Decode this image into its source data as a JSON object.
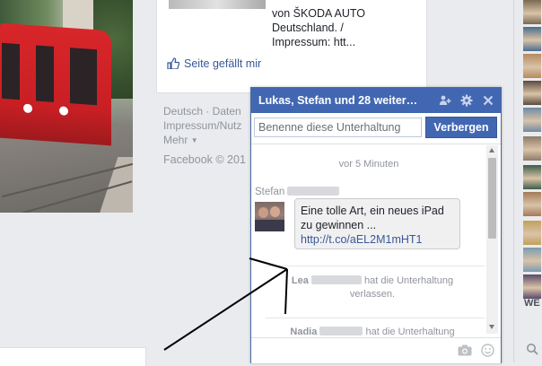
{
  "page_card": {
    "description_lines": [
      "von ŠKODA AUTO",
      "Deutschland. /",
      "Impressum: htt..."
    ],
    "like_label": "Seite gefällt mir"
  },
  "footer": {
    "line1": "Deutsch · Daten",
    "line2": "Impressum/Nutz",
    "more": "Mehr",
    "copyright": "Facebook © 201"
  },
  "chat": {
    "title": "Lukas, Stefan und 28 weiter…",
    "name_placeholder": "Benenne diese Unterhaltung",
    "hide_button": "Verbergen",
    "time_divider": "vor 5 Minuten",
    "sender_first_name": "Stefan",
    "message_text": "Eine tolle Art, ein neues iPad zu gewinnen ...",
    "message_link": "http://t.co/aEL2M1mHT1",
    "system_messages": [
      {
        "name": "Lea",
        "text": "hat die Unterhaltung",
        "text2": "verlassen."
      },
      {
        "name": "Nadia",
        "text": "hat die Unterhaltung",
        "text2": ""
      }
    ]
  },
  "sidebar": {
    "section_label": "WE",
    "avatar_colors": [
      "#7a6a52",
      "#4a6d8c",
      "#b58a5e",
      "#5c4a3e",
      "#6f8aa5",
      "#8d7b6a",
      "#3e5d4a",
      "#a37a5a",
      "#c2a15a",
      "#7b9bb0",
      "#5a4a6a",
      "#8c6a5a",
      "#c0b090"
    ]
  }
}
